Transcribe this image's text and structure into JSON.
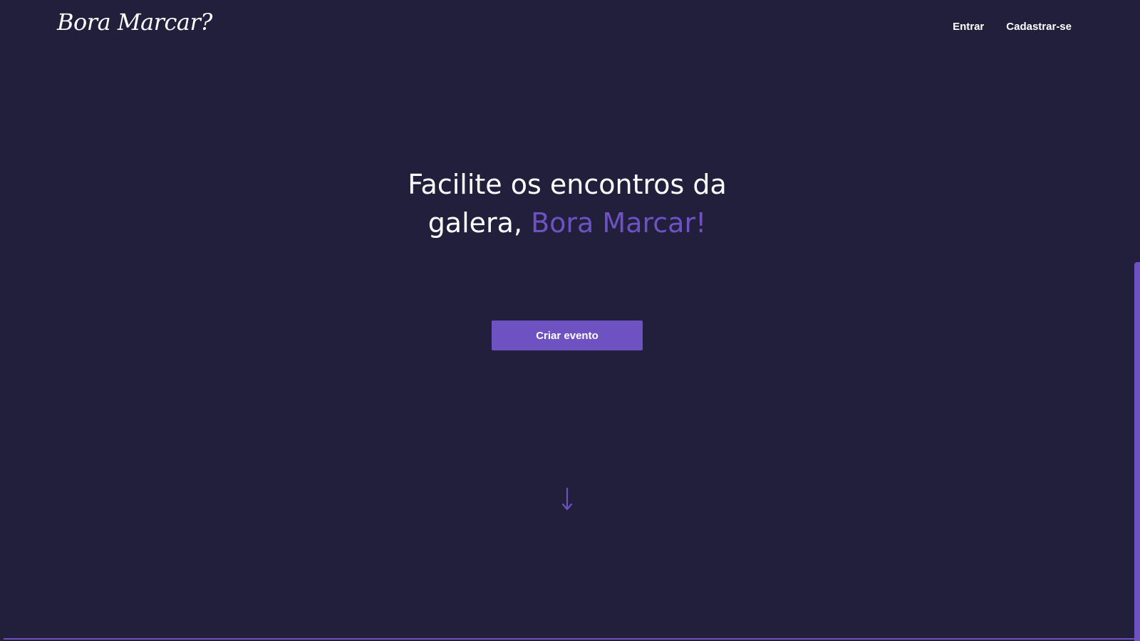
{
  "header": {
    "logo_text": "Bora Marcar?",
    "nav": {
      "login_label": "Entrar",
      "signup_label": "Cadastrar-se"
    }
  },
  "hero": {
    "title_part1": "Facilite os encontros da galera, ",
    "title_accent": "Bora Marcar!",
    "cta_label": "Criar evento"
  },
  "icons": {
    "scroll_down": "arrow-down-icon"
  },
  "colors": {
    "background": "#221f3c",
    "accent": "#6e52c2",
    "text": "#ffffff"
  }
}
